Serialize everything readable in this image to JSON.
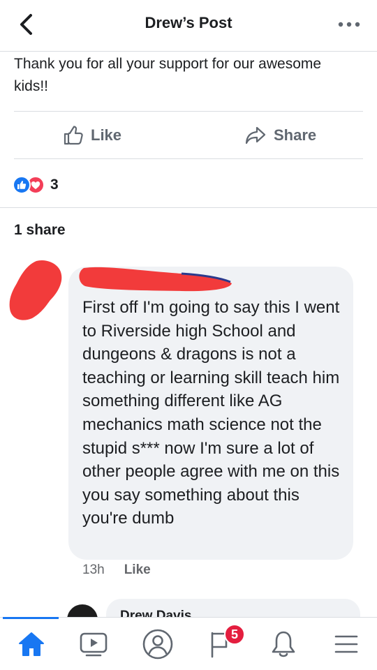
{
  "header": {
    "title": "Drew’s Post",
    "back_icon": "chevron-left-icon",
    "more_icon": "more-dots-icon"
  },
  "post": {
    "text": "Thank you for all your support for our awesome kids!!"
  },
  "actions": {
    "like_label": "Like",
    "share_label": "Share"
  },
  "reactions": {
    "types": [
      "like",
      "love"
    ],
    "count": "3"
  },
  "shares": {
    "label": "1 share"
  },
  "comment": {
    "text": "First off I'm going to say this I went to Riverside high School and dungeons & dragons is not a teaching or learning skill teach him something different like AG mechanics math science not the stupid s*** now I'm sure a lot of other people agree with me on this you say something about this you're dumb",
    "time": "13h",
    "like_label": "Like"
  },
  "reply": {
    "name": "Drew Davis"
  },
  "tabbar": {
    "tabs": [
      {
        "id": "home",
        "icon": "home-icon",
        "active": true
      },
      {
        "id": "watch",
        "icon": "video-icon",
        "active": false
      },
      {
        "id": "profile",
        "icon": "profile-icon",
        "active": false
      },
      {
        "id": "pages",
        "icon": "flag-icon",
        "active": false
      },
      {
        "id": "notifications",
        "icon": "bell-icon",
        "active": false
      },
      {
        "id": "menu",
        "icon": "menu-icon",
        "active": false
      }
    ],
    "badge_count": "5"
  },
  "colors": {
    "accent": "#1877f2",
    "love": "#f33e58",
    "badge": "#e41e3f",
    "redaction": "#f23b3b",
    "bubble": "#f0f2f5"
  }
}
